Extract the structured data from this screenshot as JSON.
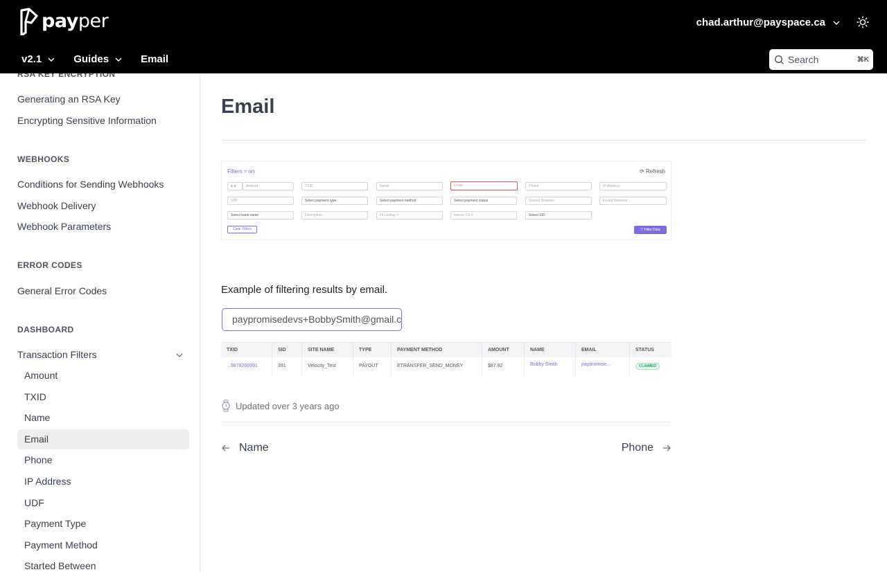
{
  "header": {
    "logo_bold": "pay",
    "logo_light": "per",
    "user_email": "chad.arthur@payspace.ca",
    "nav": [
      {
        "label": "v2.1"
      },
      {
        "label": "Guides"
      },
      {
        "label": "Email"
      }
    ],
    "search": {
      "placeholder": "Search",
      "shortcut": "⌘K"
    }
  },
  "sidebar": {
    "partial_heading": "RSA KEY ENCRYPTION",
    "sections": [
      {
        "heading": "WEBHOOKS"
      },
      {
        "heading": "ERROR CODES"
      },
      {
        "heading": "DASHBOARD"
      }
    ],
    "links": {
      "rsa_generate": "Generating an RSA Key",
      "rsa_encrypt": "Encrypting Sensitive Information",
      "wh_conditions": "Conditions for Sending Webhooks",
      "wh_delivery": "Webhook Delivery",
      "wh_params": "Webhook Parameters",
      "err_general": "General Error Codes",
      "dash_filters": "Transaction Filters"
    },
    "sub_items": [
      "Amount",
      "TXID",
      "Name",
      "Email",
      "Phone",
      "IP Address",
      "UDF",
      "Payment Type",
      "Payment Method",
      "Started Between"
    ],
    "active_sub": "Email"
  },
  "main": {
    "title": "Email",
    "filter_panel": {
      "title": "Filters ▿ on",
      "refresh": "⟳ Refresh",
      "row1": [
        "≡ ∨",
        "Amount",
        "TXID",
        "Name",
        "Email",
        "Phone",
        "IP Address"
      ],
      "row2": [
        "UDF",
        "Select payment type",
        "Select payment method",
        "Select payment status",
        "Started Between",
        "Ended Between"
      ],
      "row3": [
        "Select bank name",
        "Description",
        "Fii Lookup #",
        "Interac CX #",
        "Select SID"
      ],
      "clear": "Clear Filters",
      "apply": "⛉ Filter Data"
    },
    "description": "Example of filtering results by email.",
    "email_value": "paypromisedevs+BobbySmith@gmail.com",
    "table": {
      "headers": [
        "TXID",
        "SID",
        "SITE NAME",
        "TYPE",
        "PAYMENT METHOD",
        "AMOUNT",
        "NAME",
        "EMAIL",
        "STATUS"
      ],
      "row": [
        "...9879266991",
        "391",
        "Velocity_Test",
        "PAYOUT",
        "ETRANSFER_SEND_MONEY",
        "$87.92",
        "Bobby Smith",
        "paypromise...",
        "CLAIMED"
      ]
    },
    "updated": "Updated over 3 years ago",
    "prev_label": "Name",
    "next_label": "Phone"
  },
  "colors": {
    "header_bg": "#000000",
    "accent": "#7c6ce0",
    "active_bg": "#eeeeee",
    "status_green": "#22a35a",
    "highlight_red": "#e05050"
  }
}
